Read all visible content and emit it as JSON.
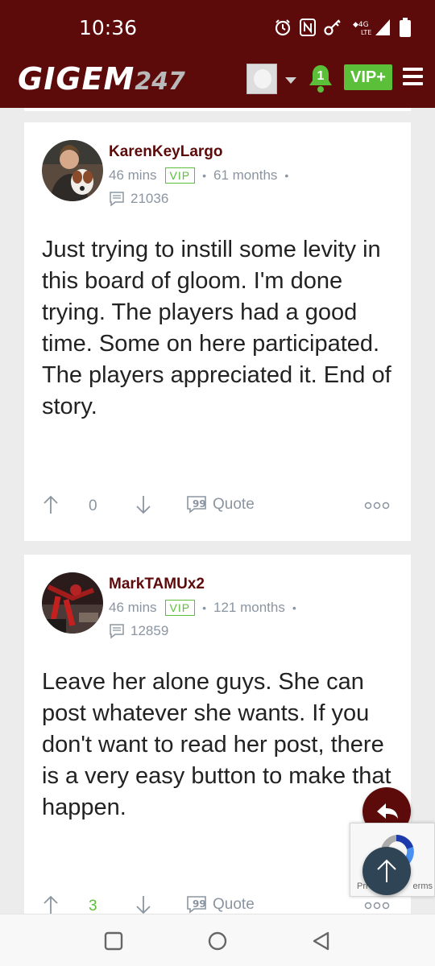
{
  "status_bar": {
    "time": "10:36",
    "network": "4G LTE"
  },
  "header": {
    "logo_text": "GIGEM",
    "logo_number": "247",
    "notification_count": "1",
    "vip_button": "VIP+",
    "colors": {
      "brand": "#5c0a0a",
      "accent": "#5bbf3a"
    }
  },
  "posts": [
    {
      "username": "KarenKeyLargo",
      "time_ago": "46 mins",
      "badge": "VIP",
      "tenure": "61 months",
      "post_count": "21036",
      "body": "Just trying to instill some levity in this board of gloom. I'm done trying. The players had a good time. Some on here participated. The players appreciated it. End of story.",
      "votes": "0",
      "quote_label": "Quote"
    },
    {
      "username": "MarkTAMUx2",
      "time_ago": "46 mins",
      "badge": "VIP",
      "tenure": "121 months",
      "post_count": "12859",
      "body": "Leave her alone guys. She can post whatever she wants. If you don't want to read her post, there is a very easy button to make that happen.",
      "votes": "3",
      "quote_label": "Quote"
    }
  ],
  "recaptcha": {
    "privacy_label": "Pri",
    "terms_label": "erms"
  }
}
